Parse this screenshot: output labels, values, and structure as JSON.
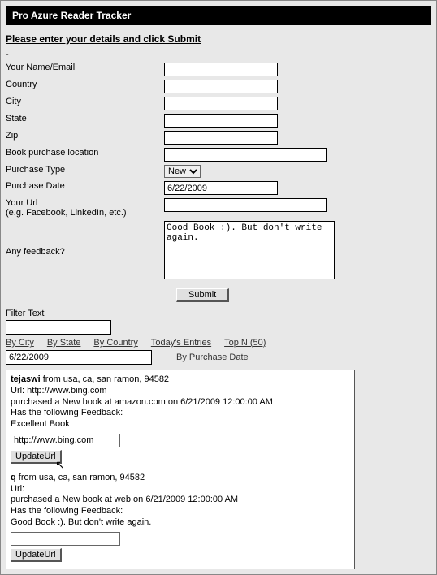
{
  "title": "Pro Azure Reader Tracker",
  "prompt": "Please enter your details and click Submit",
  "form": {
    "name_label": "Your Name/Email",
    "country_label": "Country",
    "city_label": "City",
    "state_label": "State",
    "zip_label": "Zip",
    "location_label": "Book purchase location",
    "ptype_label": "Purchase Type",
    "ptype_value": "New",
    "pdate_label": "Purchase Date",
    "pdate_value": "6/22/2009",
    "url_label": "Your Url",
    "url_sublabel": "(e.g. Facebook, LinkedIn, etc.)",
    "feedback_label": "Any feedback?",
    "feedback_value": "Good Book :). But don't write again.",
    "submit_label": "Submit"
  },
  "filter": {
    "label": "Filter Text",
    "links": {
      "by_city": "By City",
      "by_state": "By State",
      "by_country": "By Country",
      "today": "Today's Entries",
      "topn": "Top N (50)",
      "by_date": "By Purchase Date"
    },
    "date_value": "6/22/2009"
  },
  "entries": [
    {
      "name": "tejaswi",
      "from": " from usa, ca, san ramon, 94582",
      "url_line": "Url: http://www.bing.com",
      "purchase_line": "purchased a New book at amazon.com on 6/21/2009 12:00:00 AM",
      "feedback_intro": "Has the following Feedback:",
      "feedback": "Excellent Book",
      "url_edit": "http://www.bing.com",
      "update_label": "UpdateUrl"
    },
    {
      "name": "q",
      "from": " from usa, ca, san ramon, 94582",
      "url_line": "Url:",
      "purchase_line": "purchased a New book at web on 6/21/2009 12:00:00 AM",
      "feedback_intro": "Has the following Feedback:",
      "feedback": "Good Book :). But don't write again.",
      "url_edit": "",
      "update_label": "UpdateUrl"
    }
  ]
}
